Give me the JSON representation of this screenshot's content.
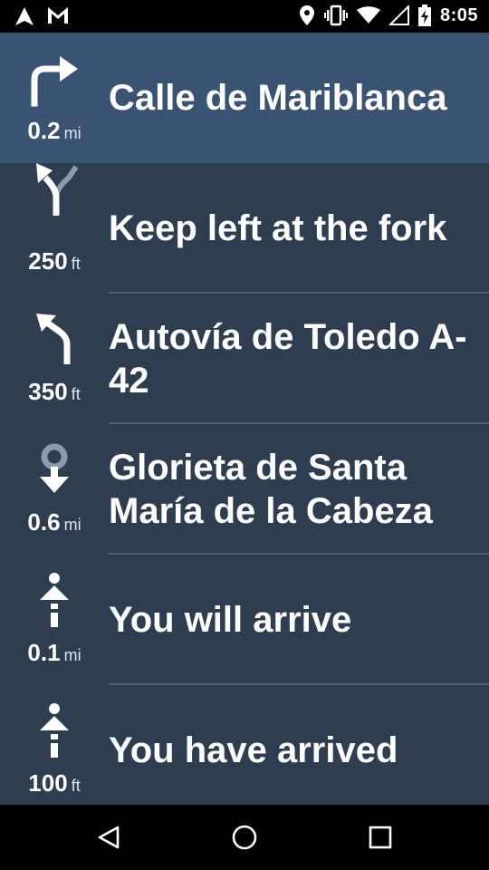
{
  "status_bar": {
    "time": "8:05",
    "icons": [
      "navigation-arrow-icon",
      "gmail-icon",
      "location-pin-icon",
      "vibrate-icon",
      "wifi-icon",
      "cell-signal-icon",
      "battery-charging-icon"
    ]
  },
  "steps": [
    {
      "distance": "0.2",
      "unit": "mi",
      "instruction": "Calle de Mariblanca",
      "icon": "turn-right-icon",
      "current": true
    },
    {
      "distance": "250",
      "unit": "ft",
      "instruction": "Keep left at the fork",
      "icon": "fork-left-icon",
      "current": false
    },
    {
      "distance": "350",
      "unit": "ft",
      "instruction": "Autovía de Toledo A-42",
      "icon": "turn-left-icon",
      "current": false
    },
    {
      "distance": "0.6",
      "unit": "mi",
      "instruction": "Glorieta de Santa María de la Cabeza",
      "icon": "roundabout-pin-icon",
      "current": false
    },
    {
      "distance": "0.1",
      "unit": "mi",
      "instruction": "You will arrive",
      "icon": "arrive-person-icon",
      "current": false
    },
    {
      "distance": "100",
      "unit": "ft",
      "instruction": "You have arrived",
      "icon": "arrived-person-icon",
      "current": false
    }
  ],
  "nav_bar": {
    "buttons": [
      "back-icon",
      "home-icon",
      "recents-icon"
    ]
  },
  "colors": {
    "current_row": "#3b5372",
    "list_bg": "#2e3d4f",
    "divider": "#4f5e70"
  }
}
